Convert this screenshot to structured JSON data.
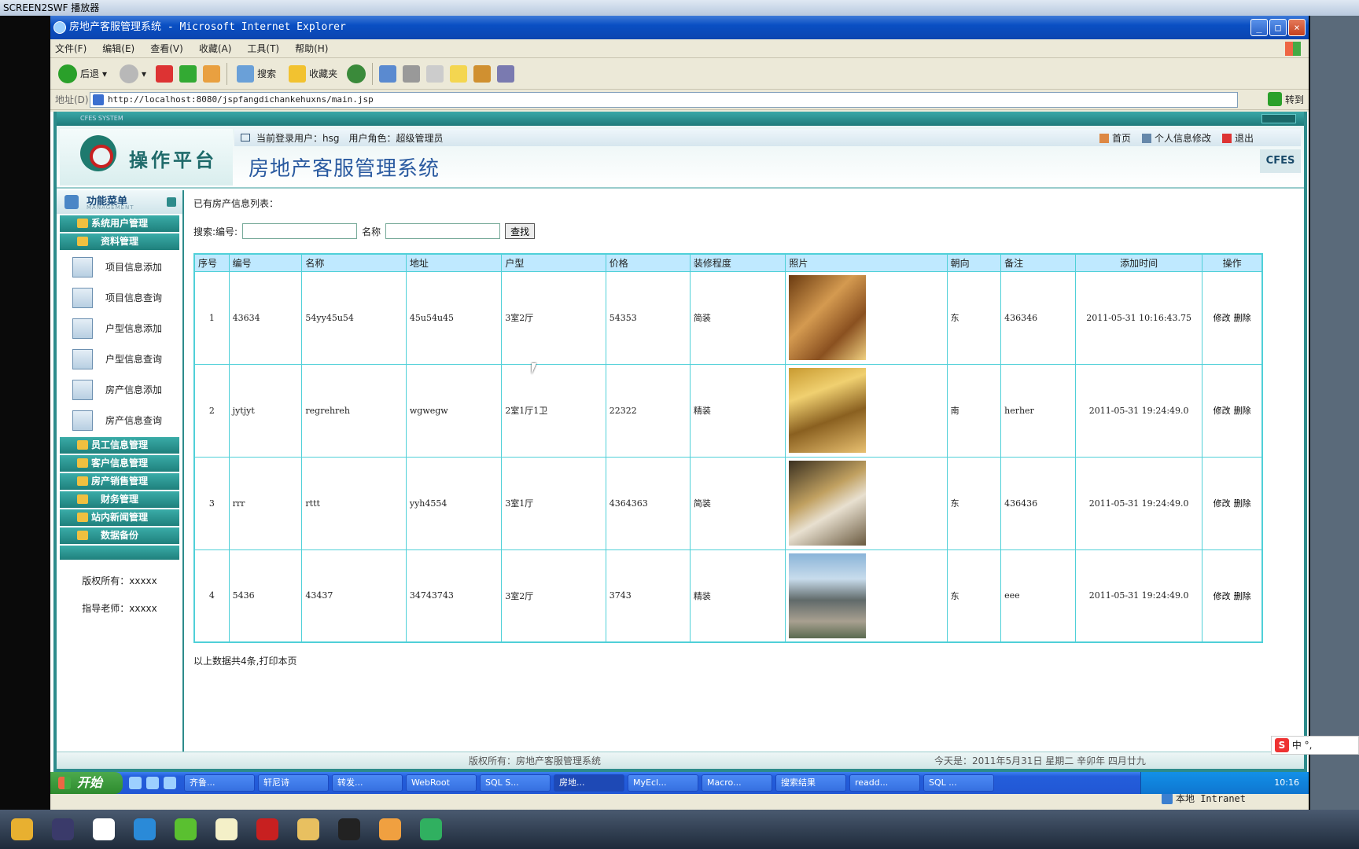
{
  "outer_window": {
    "title": "SCREEN2SWF 播放器"
  },
  "ie": {
    "title": "房地产客服管理系统 - Microsoft Internet Explorer",
    "menus": [
      "文件(F)",
      "编辑(E)",
      "查看(V)",
      "收藏(A)",
      "工具(T)",
      "帮助(H)"
    ],
    "toolbar": {
      "back": "后退",
      "search": "搜索",
      "favorites": "收藏夹"
    },
    "address_label": "地址(D)",
    "address": "http://localhost:8080/jspfangdichankehuxns/main.jsp",
    "go": "转到",
    "status_zone": "本地 Intranet"
  },
  "app": {
    "frame_label": "CFES SYSTEM",
    "logo_text": "操作平台",
    "current_user_label": "当前登录用户：hsg",
    "role_label": "用户角色：超级管理员",
    "links": {
      "home": "首页",
      "profile": "个人信息修改",
      "logout": "退出"
    },
    "title": "房地产客服管理系统",
    "brand": "CFES"
  },
  "sidebar": {
    "header": "功能菜单",
    "header_sub": "MANAGEMENT",
    "groups_top": [
      "系统用户管理",
      "资料管理"
    ],
    "sub_items": [
      "项目信息添加",
      "项目信息查询",
      "户型信息添加",
      "户型信息查询",
      "房产信息添加",
      "房产信息查询"
    ],
    "groups_bottom": [
      "员工信息管理",
      "客户信息管理",
      "房产销售管理",
      "财务管理",
      "站内新闻管理",
      "数据备份"
    ],
    "copyright": "版权所有：xxxxx",
    "advisor": "指导老师：xxxxx"
  },
  "main": {
    "list_title": "已有房产信息列表：",
    "search_label": "搜索:编号:",
    "name_label": "名称",
    "search_button": "查找",
    "columns": [
      "序号",
      "编号",
      "名称",
      "地址",
      "户型",
      "价格",
      "装修程度",
      "照片",
      "朝向",
      "备注",
      "添加时间",
      "操作"
    ],
    "rows": [
      [
        "1",
        "43634",
        "54yy45u54",
        "45u54u45",
        "3室2厅",
        "54353",
        "简装",
        "",
        "东",
        "436346",
        "2011-05-31 10:16:43.75"
      ],
      [
        "2",
        "jytjyt",
        "regrehreh",
        "wgwegw",
        "2室1厅1卫",
        "22322",
        "精装",
        "",
        "南",
        "herher",
        "2011-05-31 19:24:49.0"
      ],
      [
        "3",
        "rrr",
        "rttt",
        "yyh4554",
        "3室1厅",
        "4364363",
        "简装",
        "",
        "东",
        "436436",
        "2011-05-31 19:24:49.0"
      ],
      [
        "4",
        "5436",
        "43437",
        "34743743",
        "3室2厅",
        "3743",
        "精装",
        "",
        "东",
        "eee",
        "2011-05-31 19:24:49.0"
      ]
    ],
    "op_edit": "修改",
    "op_delete": "删除",
    "summary": "以上数据共4条,打印本页"
  },
  "footer": {
    "copyright": "版权所有：房地产客服管理系统",
    "date": "今天是：2011年5月31日 星期二 辛卯年 四月廿九"
  },
  "xp_taskbar": {
    "start": "开始",
    "tasks": [
      "齐鲁...",
      "轩尼诗",
      "转发...",
      "WebRoot",
      "SQL S...",
      "房地...",
      "MyEcl...",
      "Macro...",
      "搜索结果",
      "readd...",
      "SQL ..."
    ],
    "clock": "10:16"
  },
  "ime": {
    "label": "中 °,"
  }
}
